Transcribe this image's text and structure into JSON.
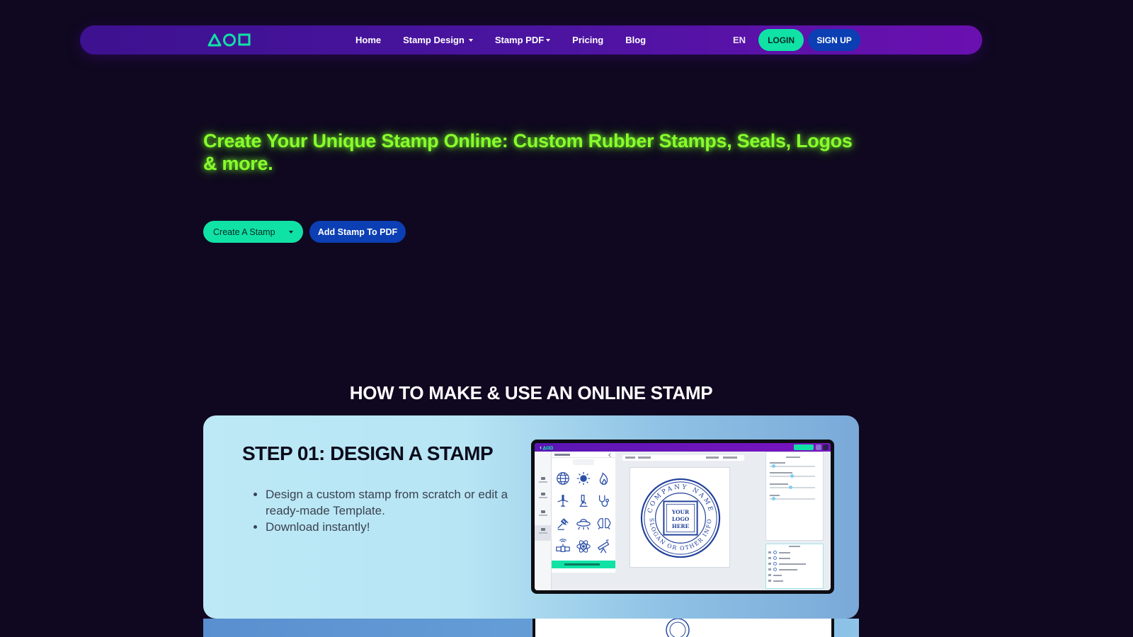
{
  "brand": {
    "accent_green": "#10e2a6",
    "accent_blue": "#0b3fb3",
    "headline_green": "#88ff2c"
  },
  "nav": {
    "links": [
      {
        "label": "Home",
        "dropdown": false
      },
      {
        "label": "Stamp Design",
        "dropdown": true
      },
      {
        "label": "Stamp PDF",
        "dropdown": true
      },
      {
        "label": "Pricing",
        "dropdown": false
      },
      {
        "label": "Blog",
        "dropdown": false
      }
    ],
    "language": "EN",
    "login": "LOGIN",
    "signup": "SIGN UP"
  },
  "hero": {
    "title": "Create Your Unique Stamp Online: Custom Rubber Stamps, Seals, Logos & more.",
    "create_button": "Create A Stamp",
    "pdf_button": "Add Stamp To PDF"
  },
  "howto": {
    "title": "HOW TO MAKE & USE AN ONLINE STAMP",
    "step1": {
      "title": "STEP 01: DESIGN A STAMP",
      "bullets": [
        "Design a custom stamp from scratch or edit a ready-made Template.",
        "Download instantly!"
      ]
    }
  },
  "mockup": {
    "seal_top_text": "COMPANY NAME",
    "seal_bottom_text": "SLOGAN OR OTHER INFO",
    "seal_center": [
      "YOUR",
      "LOGO",
      "HERE"
    ],
    "icons": [
      "globe-icon",
      "sun-icon",
      "flame-icon",
      "airplane-icon",
      "microscope-icon",
      "stethoscope-icon",
      "gavel-icon",
      "ufo-icon",
      "brain-icon",
      "satellite-icon",
      "atom-icon",
      "telescope-icon"
    ]
  }
}
